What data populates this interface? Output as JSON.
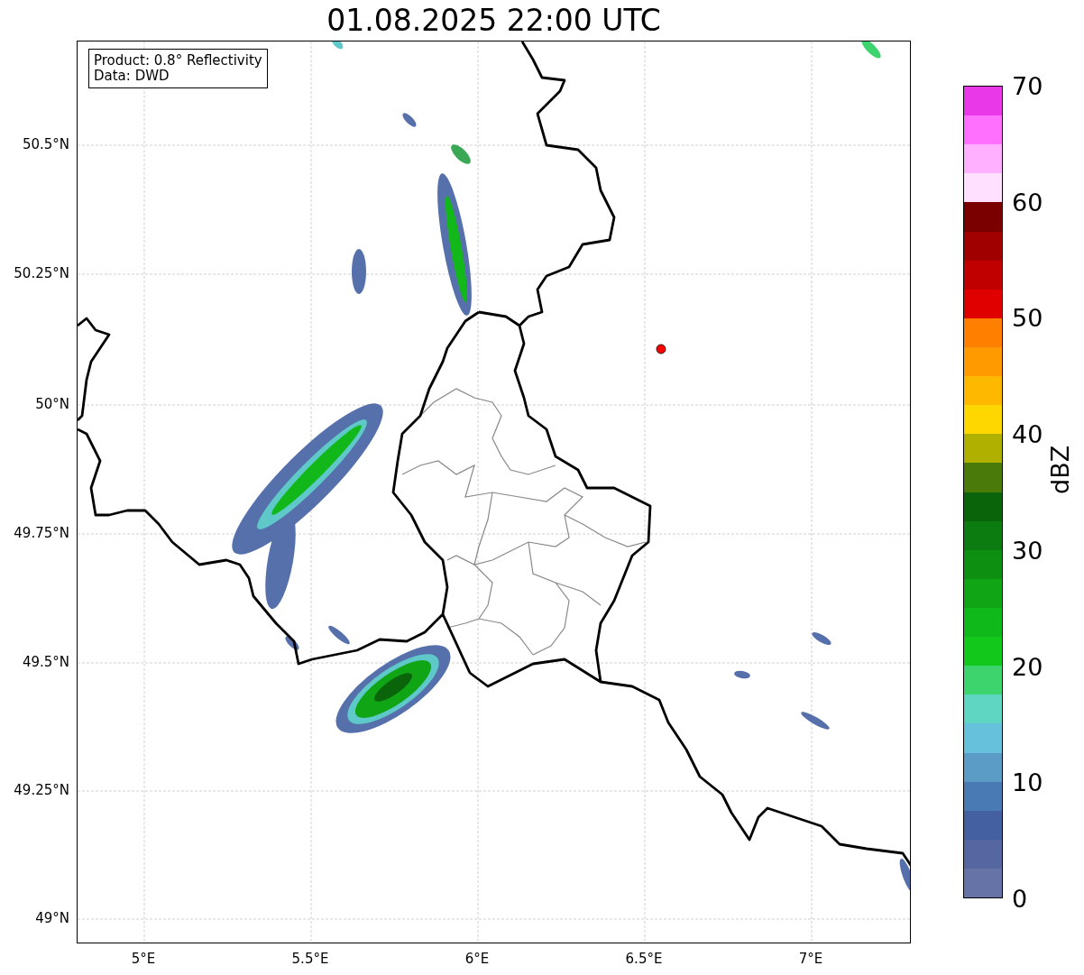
{
  "title": "01.08.2025 22:00 UTC",
  "info_box": {
    "lines": [
      "Product: 0.8° Reflectivity",
      "Data: DWD"
    ]
  },
  "map": {
    "lat_ticks": [
      "50.5°N",
      "50.25°N",
      "50°N",
      "49.75°N",
      "49.5°N",
      "49.25°N",
      "49°N"
    ],
    "lon_ticks": [
      "5°E",
      "5.5°E",
      "6°E",
      "6.5°E",
      "7°E"
    ]
  },
  "colorbar": {
    "label": "dBZ",
    "ticks": [
      "70",
      "60",
      "50",
      "40",
      "30",
      "20",
      "10",
      "0"
    ],
    "segments": [
      {
        "color": "#e838e8"
      },
      {
        "color": "#ff70ff"
      },
      {
        "color": "#ffb0ff"
      },
      {
        "color": "#ffe0ff"
      },
      {
        "color": "#7a0000"
      },
      {
        "color": "#a00000"
      },
      {
        "color": "#c00000"
      },
      {
        "color": "#e00000"
      },
      {
        "color": "#ff7f00"
      },
      {
        "color": "#ff9a00"
      },
      {
        "color": "#ffb800"
      },
      {
        "color": "#ffd700"
      },
      {
        "color": "#b0b000"
      },
      {
        "color": "#4a7a0a"
      },
      {
        "color": "#0a640a"
      },
      {
        "color": "#0c7c10"
      },
      {
        "color": "#0d9012"
      },
      {
        "color": "#0fa514"
      },
      {
        "color": "#10b91a"
      },
      {
        "color": "#12c81a"
      },
      {
        "color": "#3dd46d"
      },
      {
        "color": "#5fd6c2"
      },
      {
        "color": "#66c1dc"
      },
      {
        "color": "#5b9cc6"
      },
      {
        "color": "#4a7ab4"
      },
      {
        "color": "#4460a0"
      },
      {
        "color": "#5566a0"
      },
      {
        "color": "#6573a6"
      }
    ]
  }
}
